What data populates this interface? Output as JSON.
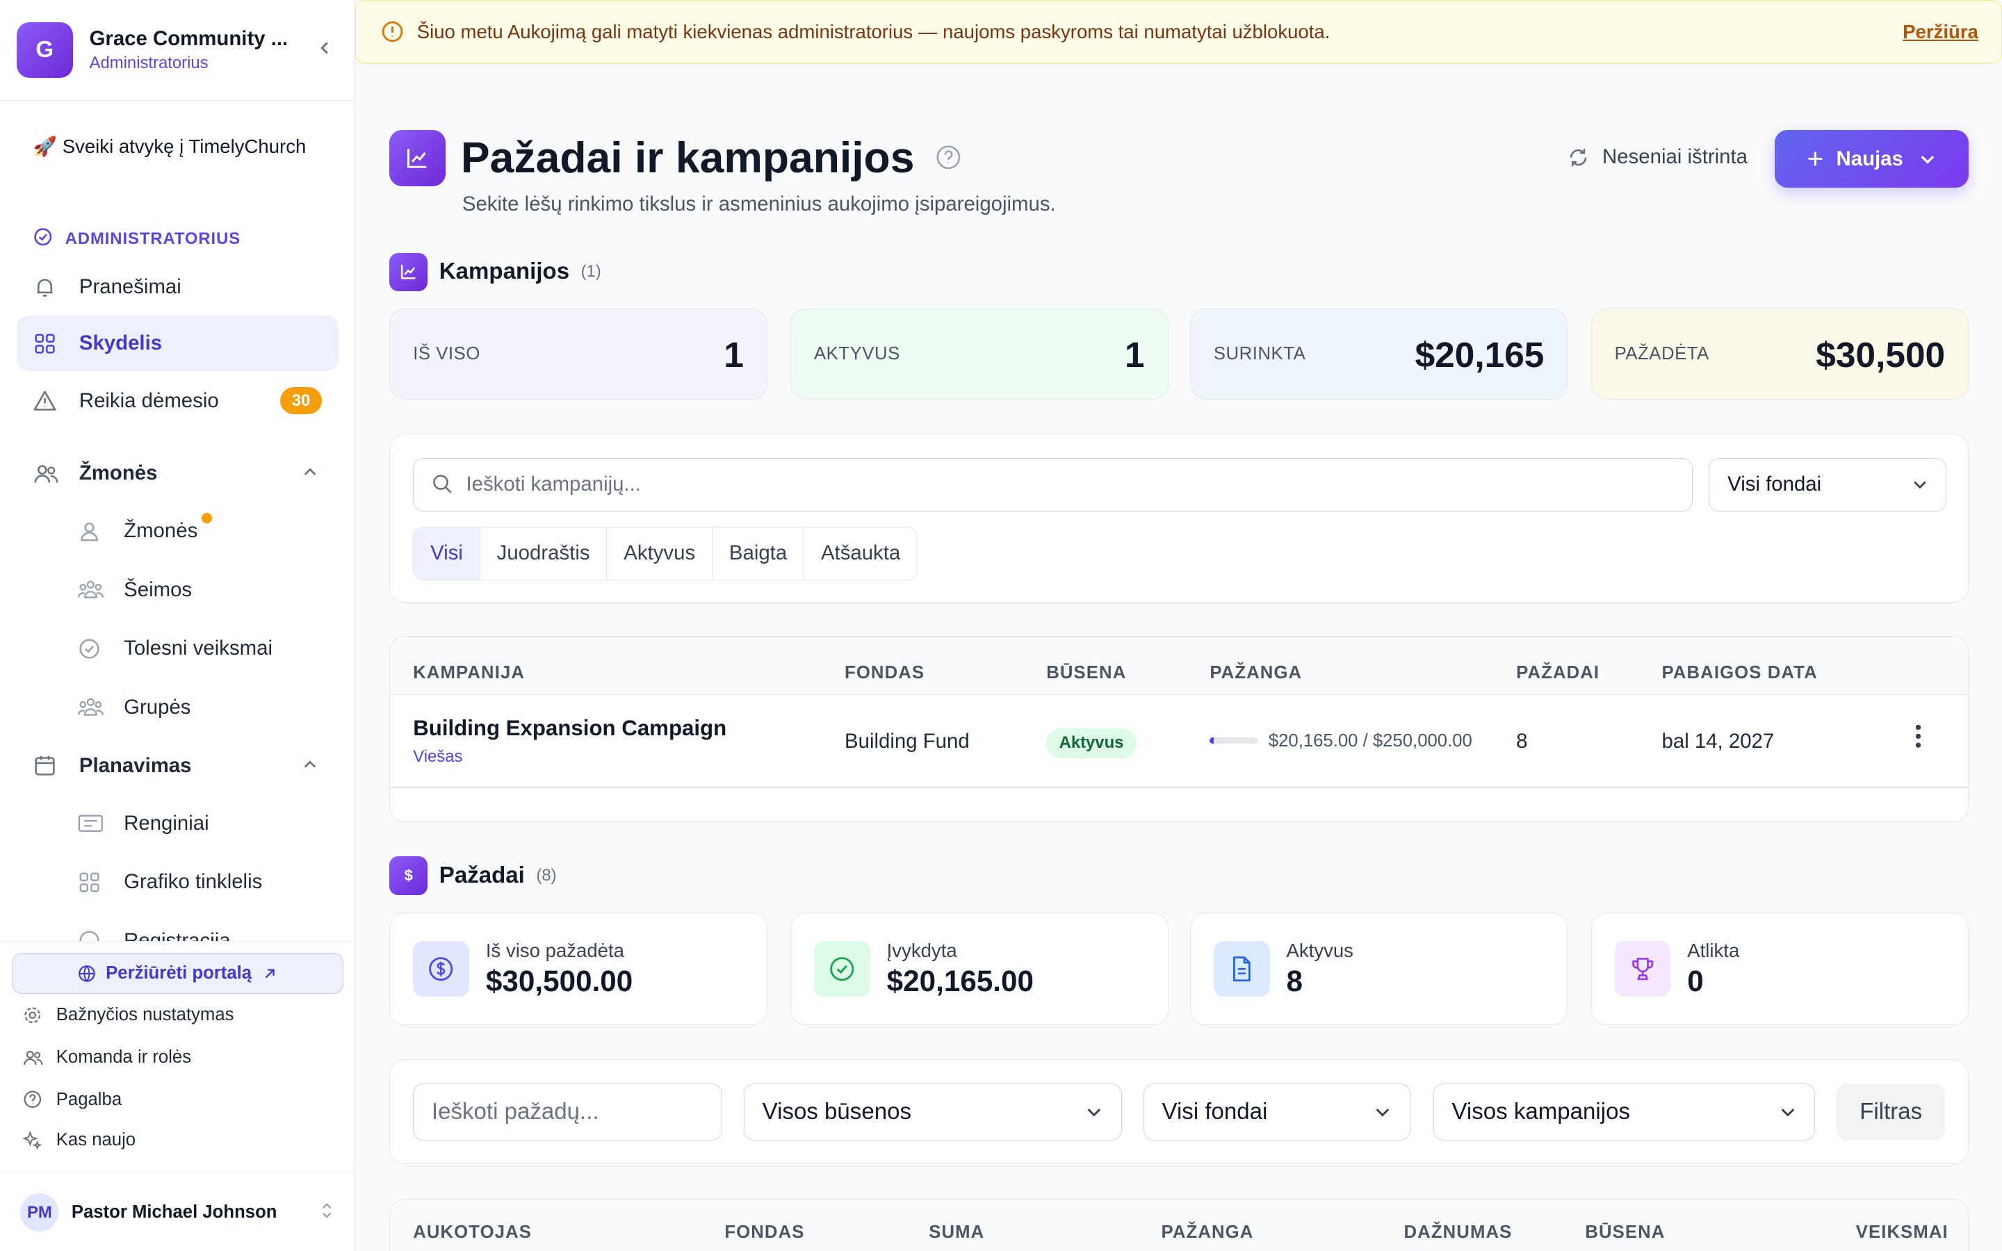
{
  "sidebar": {
    "org_initial": "G",
    "org_name": "Grace Community ...",
    "org_role": "Administratorius",
    "welcome_emoji": "🚀",
    "welcome": "Sveiki atvykę į TimelyChurch",
    "section_label": "ADMINISTRATORIUS",
    "nav": {
      "notifications": "Pranešimai",
      "dashboard": "Skydelis",
      "attention": "Reikia dėmesio",
      "attention_count": "30",
      "people_group": "Žmonės",
      "people": "Žmonės",
      "families": "Šeimos",
      "followups": "Tolesni veiksmai",
      "groups": "Grupės",
      "planning_group": "Planavimas",
      "events": "Renginiai",
      "schedule_grid": "Grafiko tinklelis",
      "registrations": "Registracija"
    },
    "footer": {
      "portal": "Peržiūrėti portalą",
      "church_settings": "Bažnyčios nustatymas",
      "team_roles": "Komanda ir rolės",
      "help": "Pagalba",
      "whats_new": "Kas naujo",
      "user_initials": "PM",
      "user_name": "Pastor Michael Johnson"
    }
  },
  "banner": {
    "text": "Šiuo metu Aukojimą gali matyti kiekvienas administratorius — naujoms paskyroms tai numatytai užblokuota.",
    "link": "Peržiūra"
  },
  "header": {
    "title": "Pažadai ir kampanijos",
    "subtitle": "Sekite lėšų rinkimo tikslus ir asmeninius aukojimo įsipareigojimus.",
    "recently_deleted": "Neseniai ištrinta",
    "new_button": "Naujas"
  },
  "campaigns": {
    "title": "Kampanijos",
    "count": "(1)",
    "stats": {
      "total_label": "IŠ VISO",
      "total": "1",
      "active_label": "AKTYVUS",
      "active": "1",
      "collected_label": "SURINKTA",
      "collected": "$20,165",
      "pledged_label": "PAŽADĖTA",
      "pledged": "$30,500"
    },
    "search_placeholder": "Ieškoti kampanijų...",
    "fund_filter": "Visi fondai",
    "tabs": [
      "Visi",
      "Juodraštis",
      "Aktyvus",
      "Baigta",
      "Atšaukta"
    ],
    "columns": {
      "campaign": "KAMPANIJA",
      "fund": "FONDAS",
      "status": "BŪSENA",
      "progress": "PAŽANGA",
      "pledges": "PAŽADAI",
      "end_date": "PABAIGOS DATA"
    },
    "rows": [
      {
        "name": "Building Expansion Campaign",
        "visibility": "Viešas",
        "fund": "Building Fund",
        "status": "Aktyvus",
        "progress_text": "$20,165.00 / $250,000.00",
        "progress_fraction": 0.0807,
        "pledges": "8",
        "end_date": "bal 14, 2027"
      }
    ]
  },
  "pledges": {
    "title": "Pažadai",
    "count": "(8)",
    "stats": {
      "total_label": "Iš viso pažadėta",
      "total": "$30,500.00",
      "fulfilled_label": "Įvykdyta",
      "fulfilled": "$20,165.00",
      "active_label": "Aktyvus",
      "active": "8",
      "done_label": "Atlikta",
      "done": "0"
    },
    "filters": {
      "search_placeholder": "Ieškoti pažadų...",
      "status": "Visos būsenos",
      "fund": "Visi fondai",
      "campaign": "Visos kampanijos",
      "filter_button": "Filtras"
    },
    "columns": {
      "donor": "AUKOTOJAS",
      "fund": "FONDAS",
      "amount": "SUMA",
      "progress": "PAŽANGA",
      "frequency": "DAŽNUMAS",
      "status": "BŪSENA",
      "actions": "VEIKSMAI"
    }
  },
  "colors": {
    "accent": "#4f46e5",
    "accent_gradient_from": "#8b5cf6",
    "accent_gradient_to": "#6d28d9",
    "warning": "#f59e0b",
    "success_bg": "#dcfce7"
  }
}
